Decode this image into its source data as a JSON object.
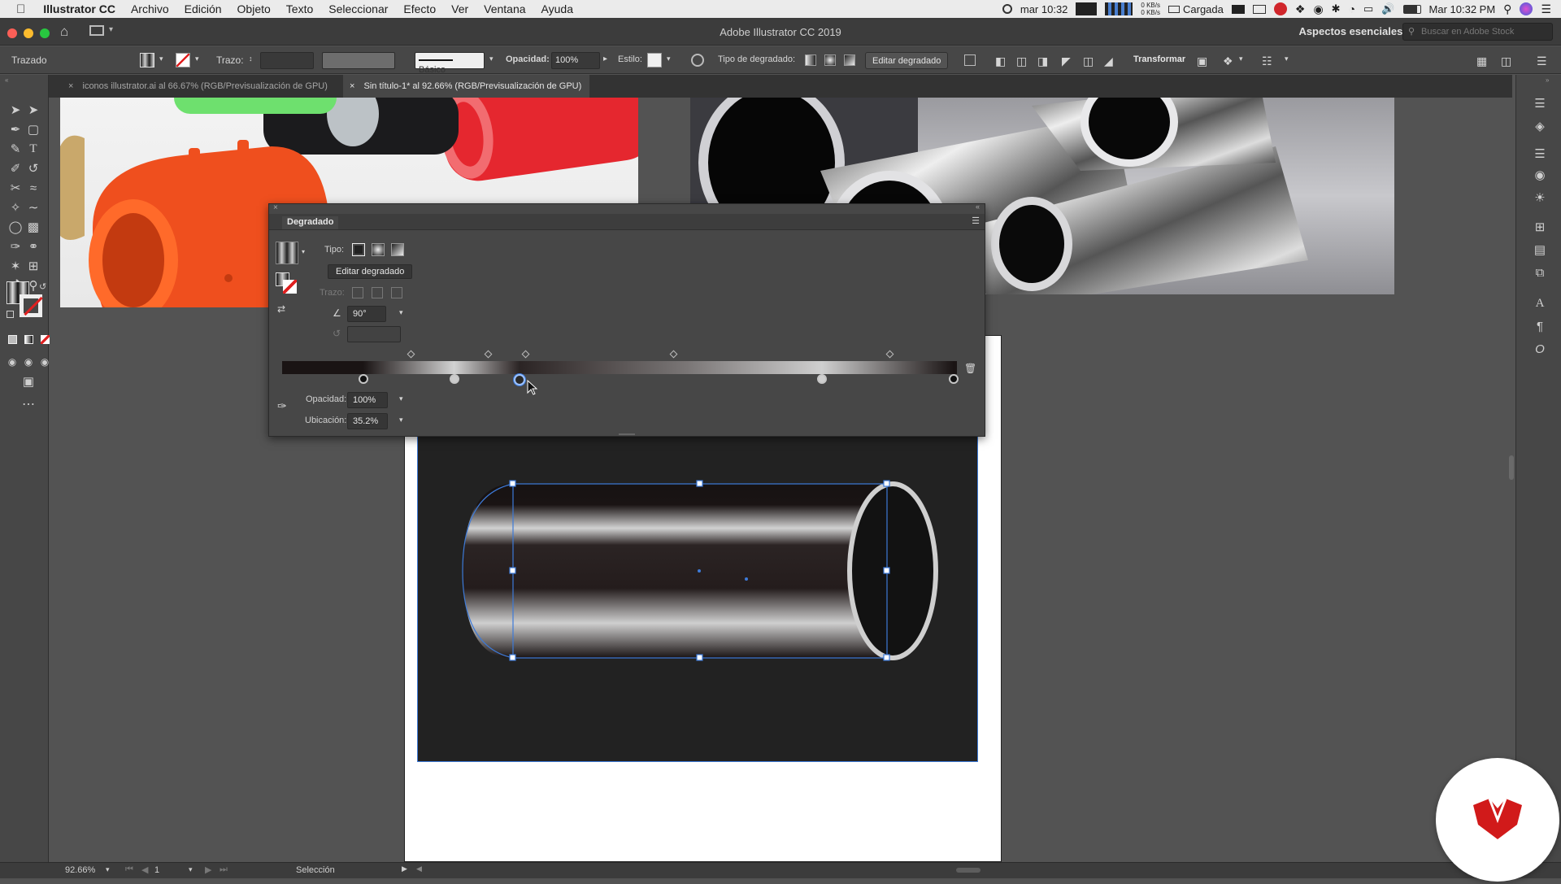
{
  "menubar": {
    "app_name": "Illustrator CC",
    "items": [
      "Archivo",
      "Edición",
      "Objeto",
      "Texto",
      "Seleccionar",
      "Efecto",
      "Ver",
      "Ventana",
      "Ayuda"
    ],
    "clock_short": "mar 10:32",
    "net_up": "0 KB/s",
    "net_down": "0 KB/s",
    "battery_label": "Cargada",
    "clock_long": "Mar 10:32 PM"
  },
  "titlebar": {
    "title": "Adobe Illustrator CC 2019",
    "workspace": "Aspectos esenciales",
    "stock_placeholder": "Buscar en Adobe Stock"
  },
  "controlbar": {
    "object_type": "Trazado",
    "stroke_label": "Trazo:",
    "brush_label": "Básico",
    "opacity_label": "Opacidad:",
    "opacity_value": "100%",
    "style_label": "Estilo:",
    "gradient_type_label": "Tipo de degradado:",
    "edit_gradient": "Editar degradado",
    "transform": "Transformar"
  },
  "tabs": [
    {
      "label": "iconos illustrator.ai al 66.67% (RGB/Previsualización de GPU)",
      "active": false
    },
    {
      "label": "Sin título-1* al 92.66% (RGB/Previsualización de GPU)",
      "active": true
    }
  ],
  "gradient_panel": {
    "title": "Degradado",
    "type_label": "Tipo:",
    "edit_button": "Editar degradado",
    "stroke_label": "Trazo:",
    "angle_value": "90°",
    "opacity_label": "Opacidad:",
    "opacity_value": "100%",
    "location_label": "Ubicación:",
    "location_value": "35.2%",
    "stops": [
      {
        "pos": 0.12,
        "color": "#111111",
        "selected": false
      },
      {
        "pos": 0.255,
        "color": "#cccccc",
        "selected": false
      },
      {
        "pos": 0.352,
        "color": "#2a2a2a",
        "selected": true
      },
      {
        "pos": 0.8,
        "color": "#cfcfcf",
        "selected": false
      },
      {
        "pos": 0.995,
        "color": "#111111",
        "selected": false
      }
    ],
    "midpoints": [
      0.19,
      0.305,
      0.36,
      0.58,
      0.9
    ]
  },
  "statusbar": {
    "zoom": "92.66%",
    "page": "1",
    "tool_name": "Selección"
  },
  "colors": {
    "accent_blue": "#3d7ad8",
    "panel_bg": "#474747",
    "app_bg": "#535353",
    "badge_red": "#d11a1a"
  }
}
